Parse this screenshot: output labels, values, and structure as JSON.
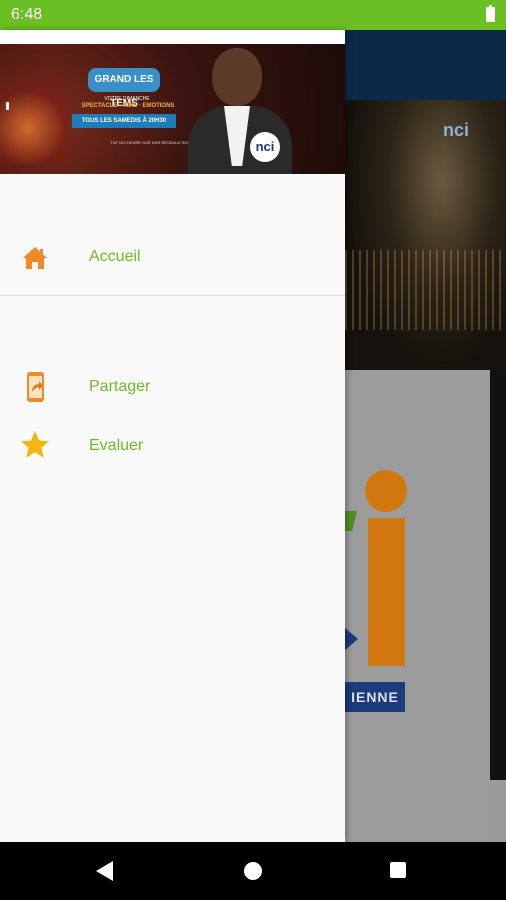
{
  "status_bar": {
    "time": "6:48"
  },
  "drawer": {
    "banner": {
      "show_title": "GRAND LES TEMS",
      "tagline": "VOTRE DIMANCHE",
      "subtag": "SPECTACLE · RIRE · EMOTIONS",
      "schedule": "TOUS LES SAMEDIS À 20H30",
      "footnote": "TNT NCI HEURE SUR NOS RÉSEAUX SOCIAUX",
      "badge": "nci"
    },
    "items": [
      {
        "label": "Accueil",
        "icon": "home-icon"
      },
      {
        "label": "Partager",
        "icon": "share-icon"
      },
      {
        "label": "Evaluer",
        "icon": "star-icon"
      }
    ]
  },
  "background": {
    "logo_text": "nci",
    "strip_text": "IENNE"
  },
  "colors": {
    "status_bar": "#6bbf24",
    "accent_green": "#6bbf24",
    "icon_orange": "#f08a24",
    "star_yellow": "#f5b40f",
    "brand_navy": "#1b3b7a"
  }
}
